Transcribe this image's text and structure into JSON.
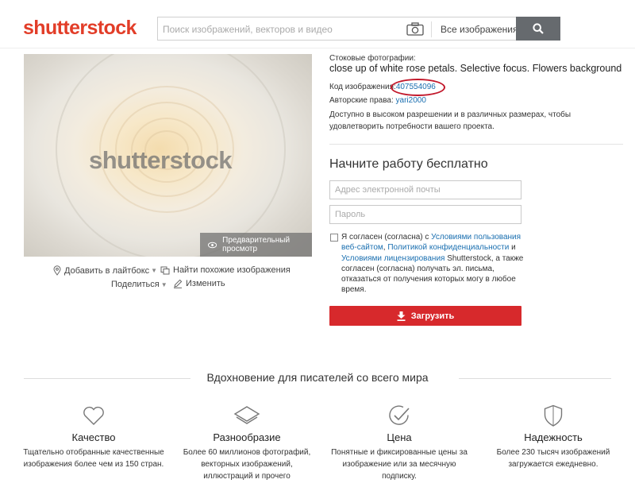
{
  "header": {
    "logo": "shutterstock",
    "search_placeholder": "Поиск изображений, векторов и видео",
    "filter_label": "Все изображения"
  },
  "image": {
    "watermark": "shutterstock",
    "preview_label": "Предварительный просмотр",
    "actions": {
      "lightbox": "Добавить в лайтбокс",
      "similar": "Найти похожие изображения",
      "share": "Поделиться",
      "edit": "Изменить"
    }
  },
  "info": {
    "category_label": "Стоковые фотографии:",
    "title": "close up of white rose petals. Selective focus. Flowers background",
    "code_label": "Код изображения:",
    "code_value": "407554096",
    "author_label": "Авторские права:",
    "author_value": "yari2000",
    "availability": "Доступно в высоком разрешении и в различных размерах, чтобы удовлетворить потребности вашего проекта."
  },
  "signup": {
    "heading": "Начните работу бесплатно",
    "email_placeholder": "Адрес электронной почты",
    "password_placeholder": "Пароль",
    "consent": {
      "part1": "Я согласен (согласна) с ",
      "link_terms": "Условиями пользования веб-сайтом",
      "part2": ", ",
      "link_privacy": "Политикой конфиденциальности",
      "part3": " и ",
      "link_license": "Условиями лицензирования",
      "part4": " Shutterstock, а также согласен (согласна) получать эл. письма, отказаться от получения которых могу в любое время."
    },
    "upload_label": "Загрузить"
  },
  "features": {
    "title": "Вдохновение для писателей со всего мира",
    "items": [
      {
        "title": "Качество",
        "desc": "Тщательно отобранные качественные изображения более чем из 150 стран."
      },
      {
        "title": "Разнообразие",
        "desc": "Более 60 миллионов фотографий, векторных изображений, иллюстраций и прочего"
      },
      {
        "title": "Цена",
        "desc": "Понятные и фиксированные цены за изображение или за месячную подписку."
      },
      {
        "title": "Надежность",
        "desc": "Более 230 тысяч изображений загружается ежедневно."
      }
    ]
  },
  "colors": {
    "brand_red": "#e23d28",
    "button_red": "#d7292c",
    "link_blue": "#1a6fb0",
    "highlight_circle": "#c2182b"
  }
}
